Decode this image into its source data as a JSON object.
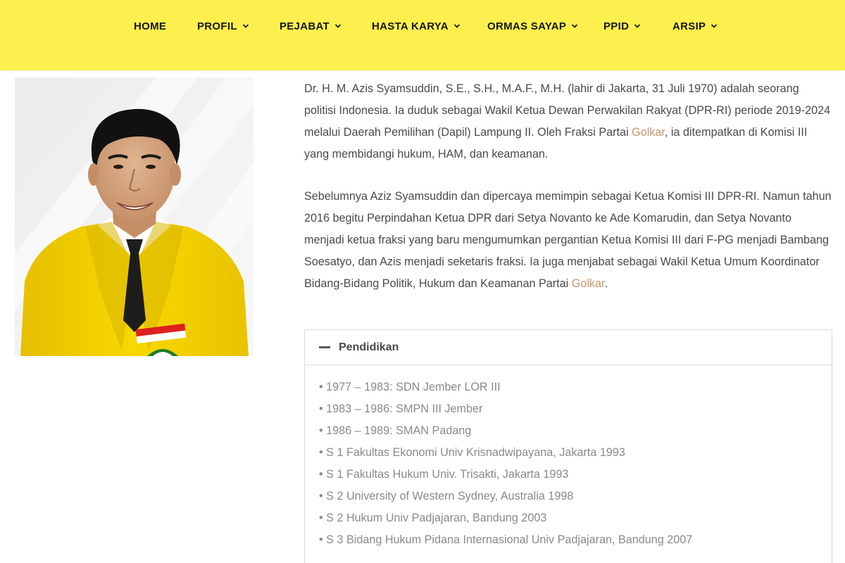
{
  "nav": {
    "items": [
      {
        "label": "HOME",
        "dropdown": false
      },
      {
        "label": "PROFIL",
        "dropdown": true
      },
      {
        "label": "PEJABAT",
        "dropdown": true
      },
      {
        "label": "HASTA KARYA",
        "dropdown": true
      },
      {
        "label": "ORMAS SAYAP",
        "dropdown": true
      },
      {
        "label": "PPID",
        "dropdown": true
      },
      {
        "label": "ARSIP",
        "dropdown": true
      }
    ],
    "chevron_icon": "chevron-down-icon"
  },
  "colors": {
    "nav_background": "#fdf04e",
    "link": "#c8956a",
    "body_text": "#4a4a4a",
    "list_text": "#8a8a8a",
    "jacket_yellow": "#f5d400"
  },
  "bio": {
    "paragraph1": {
      "before": "Dr. H. M. Azis Syamsuddin, S.E., S.H., M.A.F., M.H. (lahir di Jakarta, 31 Juli 1970) adalah seorang politisi Indonesia. Ia duduk sebagai Wakil Ketua Dewan Perwakilan Rakyat (DPR-RI) periode 2019-2024 melalui Daerah Pemilihan (Dapil) Lampung II. Oleh Fraksi Partai ",
      "link": "Golkar",
      "after": ", ia ditempatkan di Komisi III yang membidangi hukum, HAM, dan keamanan."
    },
    "paragraph2": {
      "before": "Sebelumnya Aziz Syamsuddin dan dipercaya memimpin sebagai Ketua Komisi III DPR-RI. Namun tahun 2016 begitu Perpindahan Ketua DPR dari Setya Novanto ke Ade Komarudin, dan Setya Novanto menjadi ketua fraksi yang baru mengumumkan pergantian Ketua Komisi III dari F-PG menjadi Bambang Soesatyo, dan Azis menjadi seketaris fraksi. Ia juga menjabat sebagai Wakil Ketua Umum Koordinator Bidang-Bidang Politik, Hukum dan Keamanan Partai ",
      "link": "Golkar",
      "after": "."
    }
  },
  "education": {
    "title": "Pendidikan",
    "expanded": true,
    "items": [
      "• 1977 – 1983: SDN Jember LOR III",
      "• 1983 – 1986: SMPN III Jember",
      "• 1986 – 1989: SMAN Padang",
      "• S 1 Fakultas Ekonomi Univ Krisnadwipayana, Jakarta 1993",
      "• S 1 Fakultas Hukum Univ. Trisakti, Jakarta 1993",
      "• S 2 University of Western Sydney, Australia 1998",
      "• S 2 Hukum Univ Padjajaran, Bandung 2003",
      "• S 3 Bidang Hukum Pidana Internasional Univ Padjajaran, Bandung 2007"
    ]
  }
}
